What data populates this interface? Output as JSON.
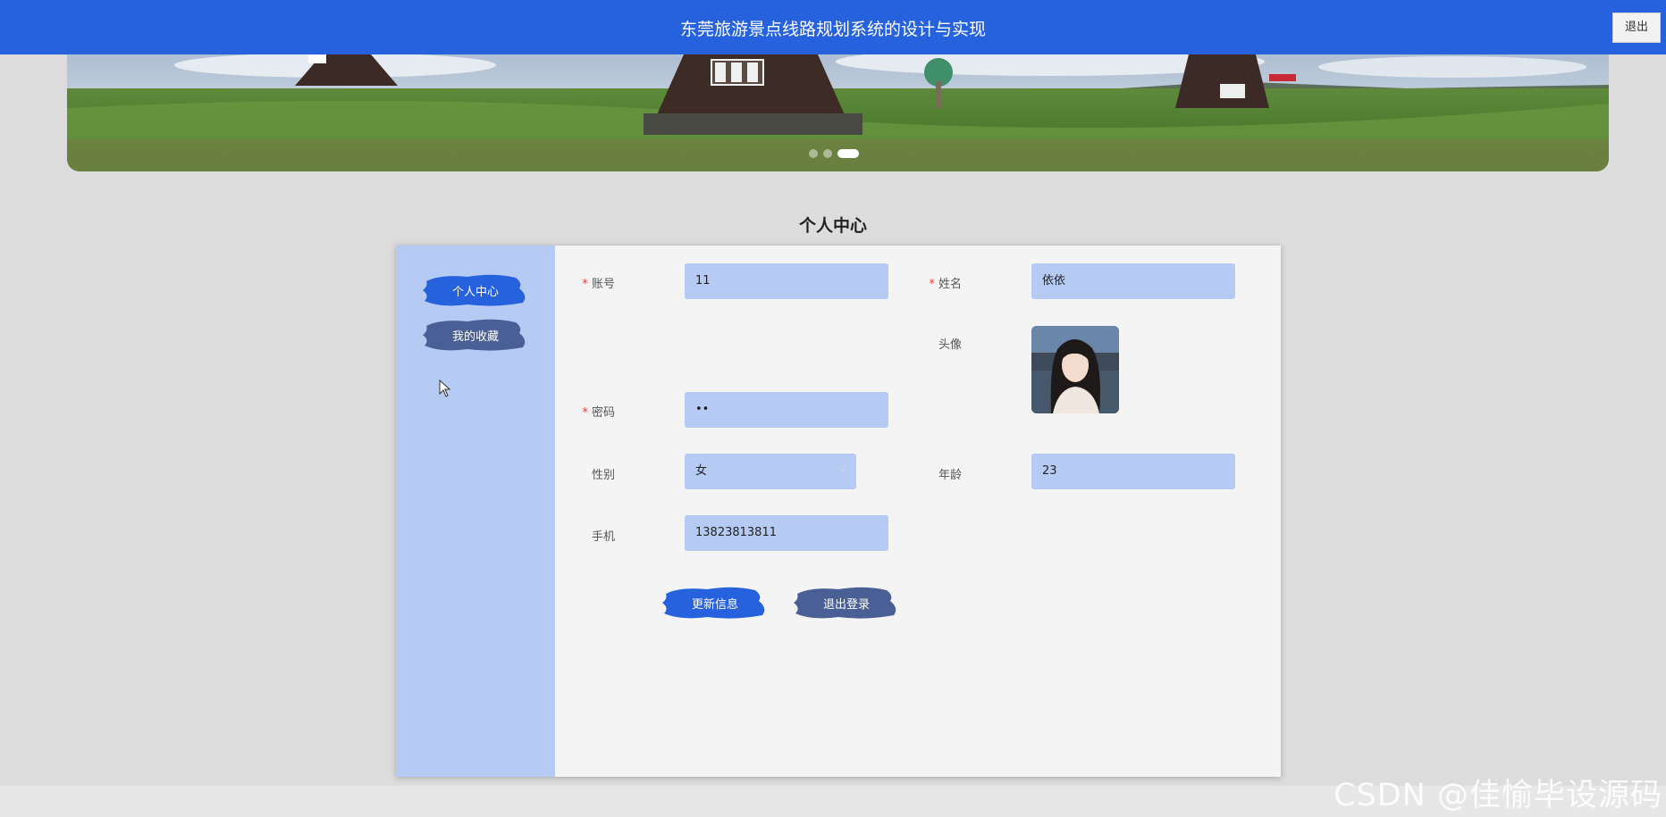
{
  "header": {
    "title": "东莞旅游景点线路规划系统的设计与实现",
    "logout_label": "退出"
  },
  "carousel": {
    "dot_count": 3,
    "active_index": 2
  },
  "page": {
    "title": "个人中心"
  },
  "sidebar": {
    "items": [
      {
        "label": "个人中心",
        "active": true
      },
      {
        "label": "我的收藏",
        "active": false
      }
    ]
  },
  "form": {
    "account": {
      "label": "账号",
      "required": true,
      "value": "11"
    },
    "name": {
      "label": "姓名",
      "required": true,
      "value": "依依"
    },
    "avatar": {
      "label": "头像"
    },
    "password": {
      "label": "密码",
      "required": true,
      "value": "••"
    },
    "gender": {
      "label": "性别",
      "value": "女"
    },
    "age": {
      "label": "年龄",
      "value": "23"
    },
    "phone": {
      "label": "手机",
      "value": "13823813811"
    },
    "update_button": "更新信息",
    "logout_button": "退出登录"
  },
  "watermark": "CSDN @佳愉毕设源码",
  "colors": {
    "header_bg": "#2762de",
    "sidebar_bg": "#b5cbf3",
    "active_brush": "#2762de",
    "inactive_brush": "#4a5f96",
    "required": "#e53e3e"
  }
}
